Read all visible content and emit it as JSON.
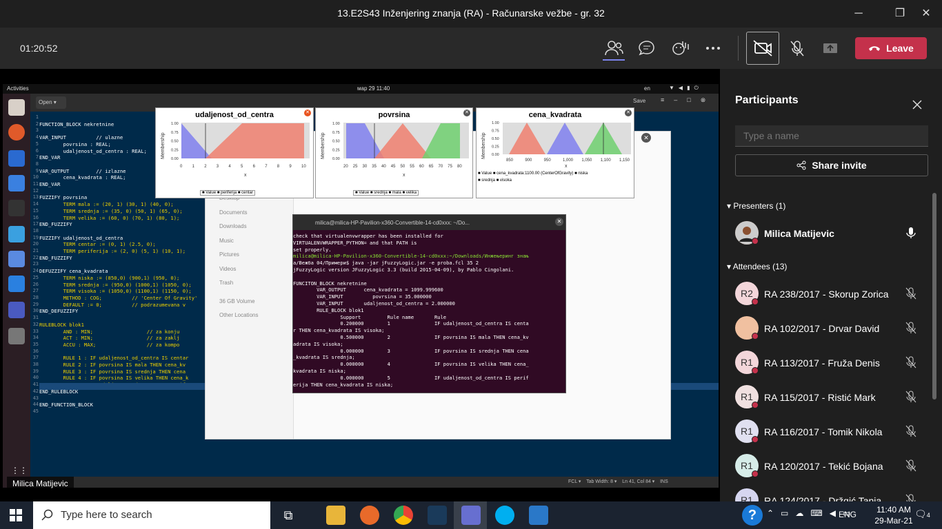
{
  "window": {
    "title": "13.E2S43 Inženjering znanja (RA) - Računarske vežbe - gr. 32",
    "min": "─",
    "max": "❐",
    "close": "✕"
  },
  "meeting": {
    "timer": "01:20:52",
    "leave_label": "Leave",
    "accent": "#c4314b"
  },
  "share": {
    "ubuntu_bar": {
      "activities": "Activities",
      "clock": "мар 29  11:40",
      "lang": "en"
    },
    "editor": {
      "open_label": "Open",
      "save_label": "Save",
      "status": "FCL ▾    Tab Width: 8 ▾    Ln 41, Col 84 ▾    INS",
      "lines": [
        "",
        "FUNCTION_BLOCK nekretnine",
        "",
        "VAR_INPUT          // ulazne",
        "        povrsina : REAL;",
        "        udaljenost_od_centra : REAL;",
        "END_VAR",
        "",
        "VAR_OUTPUT         // izlazne",
        "        cena_kvadrata : REAL;",
        "END_VAR",
        "",
        "FUZZIFY povrsina",
        "        TERM mala := (20, 1) (30, 1) (40, 0);",
        "        TERM srednja := (35, 0) (50, 1) (65, 0);",
        "        TERM velika := (60, 0) (70, 1) (80, 1);",
        "END_FUZZIFY",
        "",
        "FUZZIFY udaljenost_od_centra",
        "        TERM centar := (0, 1) (2.5, 0);",
        "        TERM periferija := (2, 0) (5, 1) (10, 1);",
        "END_FUZZIFY",
        "",
        "DEFUZZIFY cena_kvadrata",
        "        TERM niska := (850,0) (900,1) (950, 0);",
        "        TERM srednja := (950,0) (1000,1) (1050, 0);",
        "        TERM visoka := (1050,0) (1100,1) (1150, 0);",
        "        METHOD : COG;          // 'Center Of Gravity'",
        "        DEFAULT := 0;          // podrazumevana v",
        "END_DEFUZZIFY",
        "",
        "RULEBLOCK blok1",
        "        AND : MIN;                  // za konju",
        "        ACT : MIN;                  // za zaklj",
        "        ACCU : MAX;                 // za kompo",
        "",
        "        RULE 1 : IF udaljenost_od_centra IS centar",
        "        RULE 2 : IF povrsina IS mala THEN cena_kv",
        "        RULE 3 : IF povrsina IS srednja THEN cena",
        "        RULE 4 : IF povrsina IS velika THEN cena_k",
        "        RULE 5 : IF udaljenost_od_centra IS perife",
        "END_RULEBLOCK",
        "",
        "END_FUNCTION_BLOCK",
        ""
      ]
    },
    "files": {
      "items": [
        "Desktop",
        "Documents",
        "Downloads",
        "Music",
        "Pictures",
        "Videos",
        "Trash",
        "36 GB Volume",
        "Other Locations"
      ]
    },
    "plots": [
      {
        "title": "udaljenost_od_centra",
        "ylabel": "Membership",
        "xlabel": "x",
        "ticks": [
          "0",
          "1",
          "2",
          "3",
          "4",
          "5",
          "6",
          "7",
          "8",
          "9",
          "10"
        ],
        "yticks": [
          "1.00",
          "0.75",
          "0.50",
          "0.25",
          "0.00"
        ],
        "legend": "■ Value ■ periferija ■ centar"
      },
      {
        "title": "povrsina",
        "ylabel": "Membership",
        "xlabel": "x",
        "ticks": [
          "20",
          "25",
          "30",
          "35",
          "40",
          "45",
          "50",
          "55",
          "60",
          "65",
          "70",
          "75",
          "80"
        ],
        "yticks": [
          "1.00",
          "0.75",
          "0.50",
          "0.25",
          "0.00"
        ],
        "legend": "■ Value ■ srednja ■ mala ■ velika"
      },
      {
        "title": "cena_kvadrata",
        "ylabel": "Membership",
        "xlabel": "x",
        "ticks": [
          "850",
          "900",
          "950",
          "1,000",
          "1,050",
          "1,100",
          "1,150"
        ],
        "yticks": [
          "1.00",
          "0.75",
          "0.50",
          "0.25",
          "0.00"
        ],
        "legend": "■ Value ■ cena_kvadrata:1100.00 (CenterOfGravity) ■ niska",
        "legend2": "■ srednja ■ visoka"
      }
    ],
    "terminal": {
      "title": "milica@milica-HP-Pavilion-x360-Convertible-14-cd0xxx: ~/Do...",
      "lines": [
        "check that virtualenvwrapper has been installed for",
        "VIRTUALENVWRAPPER_PYTHON= and that PATH is",
        "set properly.",
        "milica@milica-HP-Pavilion-x360-Convertible-14-cd0xxx:~/Downloads/Инжењеринг знањ",
        "a/Вежба 04/Примери$ java -jar jFuzzyLogic.jar -e proba.fcl 35 2",
        "jFuzzyLogic version JFuzzyLogic 3.3 (build 2015-04-09), by Pablo Cingolani.",
        "",
        "FUNCITON_BLOCK nekretnine",
        "        VAR_OUTPUT      cena_kvadrata = 1099.999600",
        "        VAR_INPUT          povrsina = 35.000000",
        "        VAR_INPUT       udaljenost_od_centra = 2.000000",
        "        RULE_BLOCK blok1",
        "                Support         Rule name       Rule",
        "                0.200000        1               IF udaljenost_od_centra IS centa",
        "r THEN cena_kvadrata IS visoka;",
        "                0.500000        2               IF povrsina IS mala THEN cena_kv",
        "adrata IS visoka;",
        "                0.000000        3               IF povrsina IS srednja THEN cena",
        "_kvadrata IS srednja;",
        "                0.000000        4               IF povrsina IS velika THEN cena_",
        "kvadrata IS niska;",
        "                0.000000        5               IF udaljenost_od_centra IS perif",
        "erija THEN cena_kvadrata IS niska;",
        ""
      ]
    },
    "presenter_pill": "Milica Matijevic"
  },
  "panel": {
    "title": "Participants",
    "search_placeholder": "Type a name",
    "share_label": "Share invite",
    "presenters_header": "Presenters (1)",
    "attendees_header": "Attendees (13)",
    "presenters": [
      {
        "name": "Milica Matijevic",
        "initials": ""
      }
    ],
    "attendees": [
      {
        "initials": "R2",
        "name": "RA 238/2017 - Skorup Zorica"
      },
      {
        "initials": "",
        "name": "RA 102/2017 - Drvar David"
      },
      {
        "initials": "R1",
        "name": "RA 113/2017 - Fruža Denis"
      },
      {
        "initials": "R1",
        "name": "RA 115/2017 - Ristić Mark"
      },
      {
        "initials": "R1",
        "name": "RA 116/2017 - Tomik Nikola"
      },
      {
        "initials": "R1",
        "name": "RA 120/2017 - Tekić Bojana"
      },
      {
        "initials": "R1",
        "name": "RA 124/2017 - Držgić Tanja"
      }
    ]
  },
  "taskbar": {
    "search_placeholder": "Type here to search",
    "lang": "ENG",
    "time": "11:40 AM",
    "date": "29-Mar-21",
    "notif_count": "4"
  }
}
